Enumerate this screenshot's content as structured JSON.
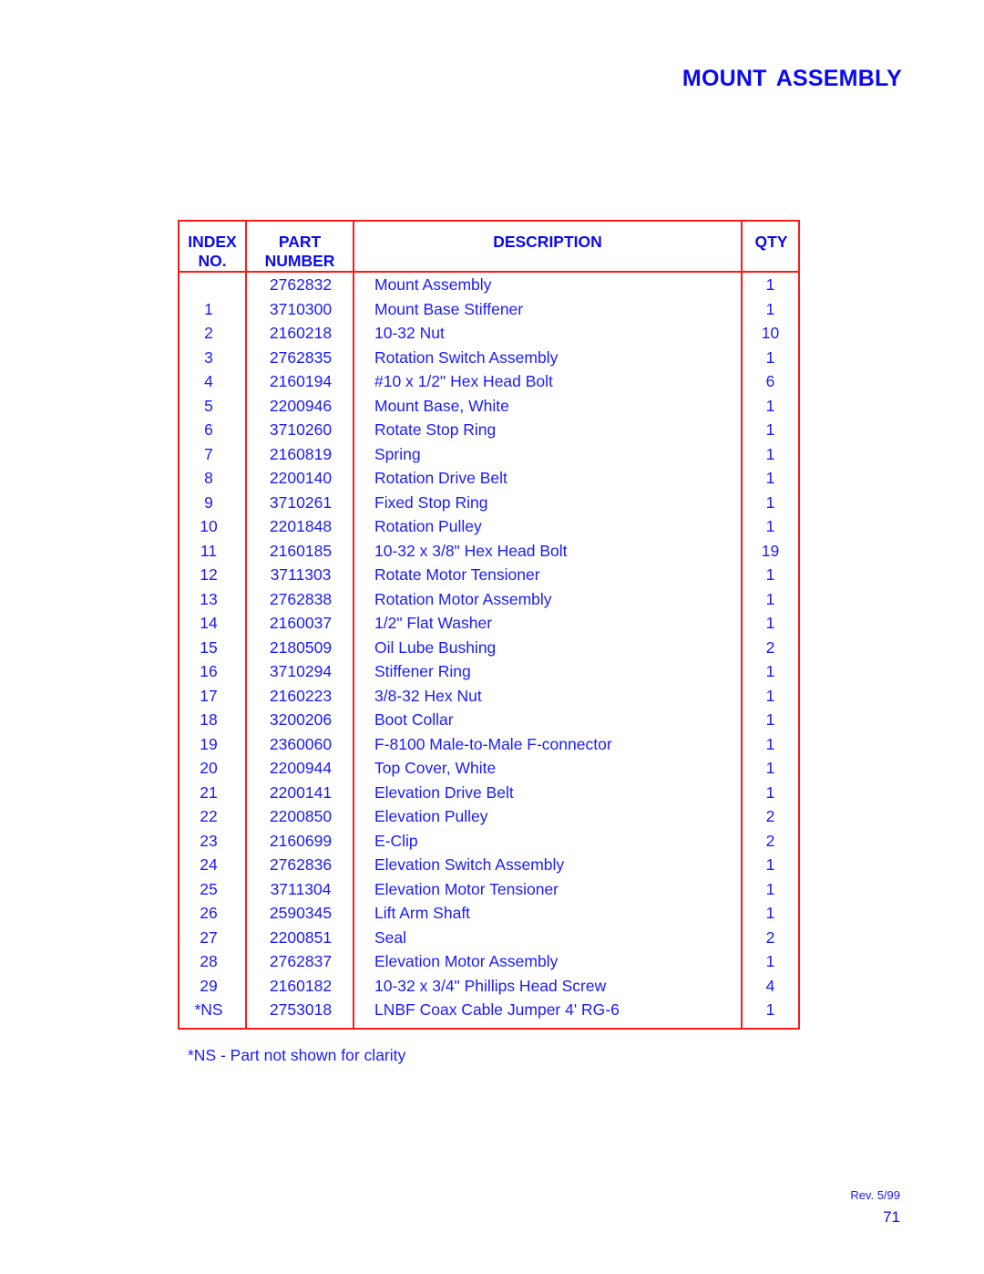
{
  "title": "MOUNT ASSEMBLY",
  "table": {
    "headers": {
      "index": "INDEX\nNO.",
      "index_line1": "INDEX",
      "index_line2": "NO.",
      "part_line1": "PART",
      "part_line2": "NUMBER",
      "description": "DESCRIPTION",
      "qty": "QTY"
    },
    "rows": [
      {
        "index": "",
        "part_number": "2762832",
        "description": "Mount Assembly",
        "qty": "1"
      },
      {
        "index": "1",
        "part_number": "3710300",
        "description": "Mount Base Stiffener",
        "qty": "1"
      },
      {
        "index": "2",
        "part_number": "2160218",
        "description": "10-32 Nut",
        "qty": "10"
      },
      {
        "index": "3",
        "part_number": "2762835",
        "description": "Rotation Switch Assembly",
        "qty": "1"
      },
      {
        "index": "4",
        "part_number": "2160194",
        "description": "#10 x 1/2\" Hex Head Bolt",
        "qty": "6"
      },
      {
        "index": "5",
        "part_number": "2200946",
        "description": "Mount Base, White",
        "qty": "1"
      },
      {
        "index": "6",
        "part_number": "3710260",
        "description": "Rotate Stop Ring",
        "qty": "1"
      },
      {
        "index": "7",
        "part_number": "2160819",
        "description": "Spring",
        "qty": "1"
      },
      {
        "index": "8",
        "part_number": "2200140",
        "description": "Rotation Drive Belt",
        "qty": "1"
      },
      {
        "index": "9",
        "part_number": "3710261",
        "description": "Fixed Stop Ring",
        "qty": "1"
      },
      {
        "index": "10",
        "part_number": "2201848",
        "description": "Rotation Pulley",
        "qty": "1"
      },
      {
        "index": "11",
        "part_number": "2160185",
        "description": "10-32 x 3/8\" Hex Head Bolt",
        "qty": "19"
      },
      {
        "index": "12",
        "part_number": "3711303",
        "description": "Rotate Motor Tensioner",
        "qty": "1"
      },
      {
        "index": "13",
        "part_number": "2762838",
        "description": "Rotation Motor Assembly",
        "qty": "1"
      },
      {
        "index": "14",
        "part_number": "2160037",
        "description": "1/2\" Flat Washer",
        "qty": "1"
      },
      {
        "index": "15",
        "part_number": "2180509",
        "description": "Oil Lube Bushing",
        "qty": "2"
      },
      {
        "index": "16",
        "part_number": "3710294",
        "description": "Stiffener Ring",
        "qty": "1"
      },
      {
        "index": "17",
        "part_number": "2160223",
        "description": "3/8-32 Hex Nut",
        "qty": "1"
      },
      {
        "index": "18",
        "part_number": "3200206",
        "description": "Boot Collar",
        "qty": "1"
      },
      {
        "index": "19",
        "part_number": "2360060",
        "description": "F-8100 Male-to-Male F-connector",
        "qty": "1"
      },
      {
        "index": "20",
        "part_number": "2200944",
        "description": "Top Cover, White",
        "qty": "1"
      },
      {
        "index": "21",
        "part_number": "2200141",
        "description": "Elevation Drive Belt",
        "qty": "1"
      },
      {
        "index": "22",
        "part_number": "2200850",
        "description": "Elevation Pulley",
        "qty": "2"
      },
      {
        "index": "23",
        "part_number": "2160699",
        "description": "E-Clip",
        "qty": "2"
      },
      {
        "index": "24",
        "part_number": "2762836",
        "description": "Elevation Switch Assembly",
        "qty": "1"
      },
      {
        "index": "25",
        "part_number": "3711304",
        "description": "Elevation Motor Tensioner",
        "qty": "1"
      },
      {
        "index": "26",
        "part_number": "2590345",
        "description": "Lift Arm Shaft",
        "qty": "1"
      },
      {
        "index": "27",
        "part_number": "2200851",
        "description": "Seal",
        "qty": "2"
      },
      {
        "index": "28",
        "part_number": "2762837",
        "description": "Elevation Motor Assembly",
        "qty": "1"
      },
      {
        "index": "29",
        "part_number": "2160182",
        "description": "10-32 x 3/4\" Phillips Head Screw",
        "qty": "4"
      },
      {
        "index": "*NS",
        "part_number": "2753018",
        "description": "LNBF Coax Cable Jumper 4' RG-6",
        "qty": "1"
      }
    ]
  },
  "footnote": "*NS - Part not shown for clarity",
  "revision": "Rev. 5/99",
  "page_number": "71",
  "colors": {
    "text": "#1a1aff",
    "title": "#0a0af0",
    "table_border": "#ff1a1a"
  }
}
